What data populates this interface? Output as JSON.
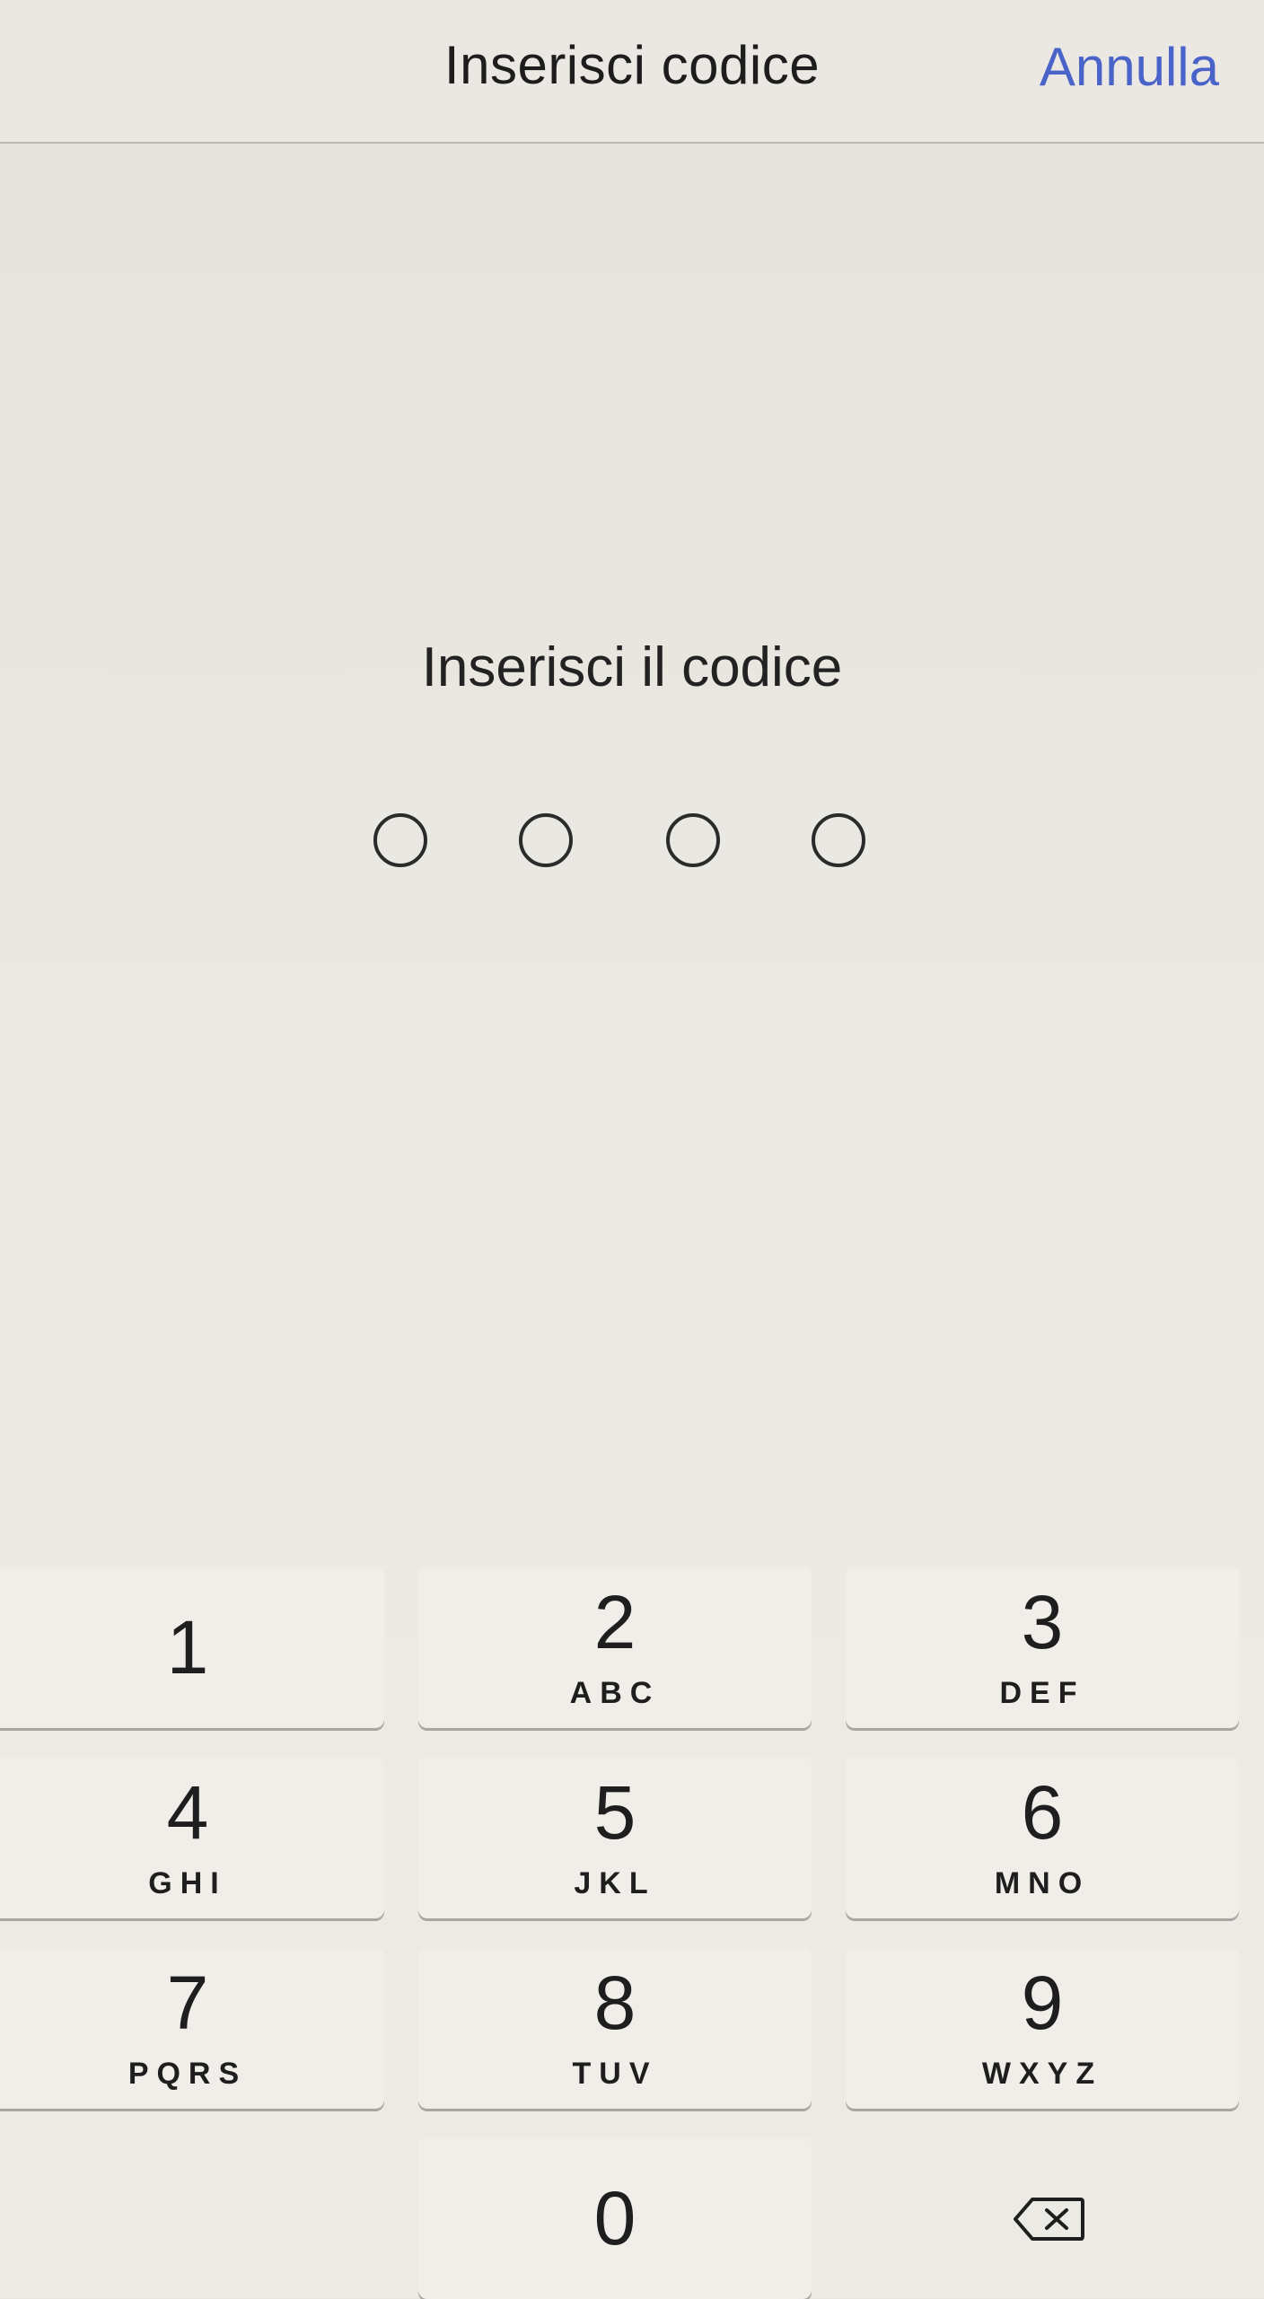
{
  "navbar": {
    "title": "Inserisci codice",
    "cancel_label": "Annulla"
  },
  "prompt": "Inserisci il codice",
  "passcode": {
    "length": 4,
    "entered": 0
  },
  "keypad": {
    "keys": [
      {
        "digit": "1",
        "letters": ""
      },
      {
        "digit": "2",
        "letters": "ABC"
      },
      {
        "digit": "3",
        "letters": "DEF"
      },
      {
        "digit": "4",
        "letters": "GHI"
      },
      {
        "digit": "5",
        "letters": "JKL"
      },
      {
        "digit": "6",
        "letters": "MNO"
      },
      {
        "digit": "7",
        "letters": "PQRS"
      },
      {
        "digit": "8",
        "letters": "TUV"
      },
      {
        "digit": "9",
        "letters": "WXYZ"
      },
      {
        "digit": "0",
        "letters": ""
      }
    ],
    "delete_icon": "backspace-icon"
  },
  "colors": {
    "accent": "#4a63c9",
    "background": "#ebe8e3",
    "key": "#f1eeea"
  }
}
